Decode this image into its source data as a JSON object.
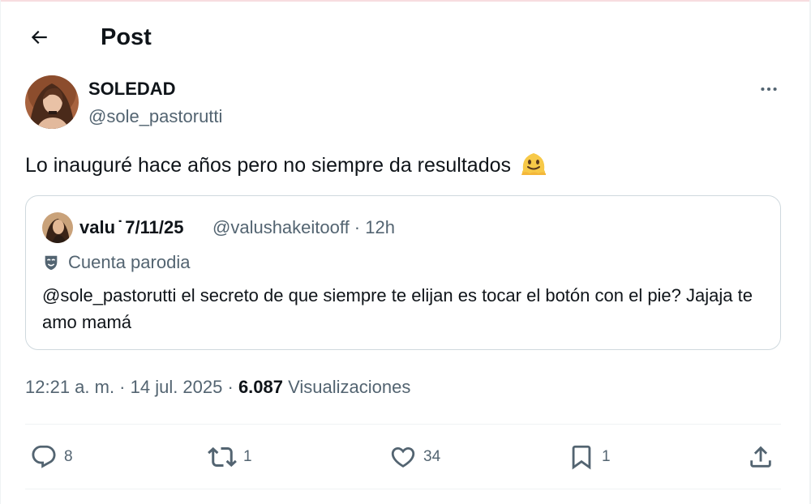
{
  "header": {
    "title": "Post",
    "back_icon": "arrow-left-icon"
  },
  "post": {
    "author": {
      "name": "SOLEDAD",
      "handle": "@sole_pastorutti"
    },
    "more_icon": "more-horizontal-icon",
    "text": "Lo inauguré hace años pero no siempre da resultados",
    "emoji": "melting-face-emoji",
    "quote": {
      "name": "valu ̇  7/11/25",
      "handle_time": "@valushakeitooff · 12h",
      "parody_label": "Cuenta parodia",
      "parody_icon": "theater-mask-icon",
      "text": "@sole_pastorutti el secreto de que siempre te elijan es tocar el botón con el pie? Jajaja te amo mamá"
    },
    "meta": {
      "datetime": "12:21 a. m. · 14 jul. 2025 · ",
      "views_count": "6.087",
      "views_label": "Visualizaciones"
    },
    "actions": {
      "replies": "8",
      "reposts": "1",
      "likes": "34",
      "bookmarks": "1"
    }
  },
  "colors": {
    "text": "#0f1419",
    "secondary": "#536471",
    "border": "#cfd9de",
    "divider": "#eff3f4"
  }
}
